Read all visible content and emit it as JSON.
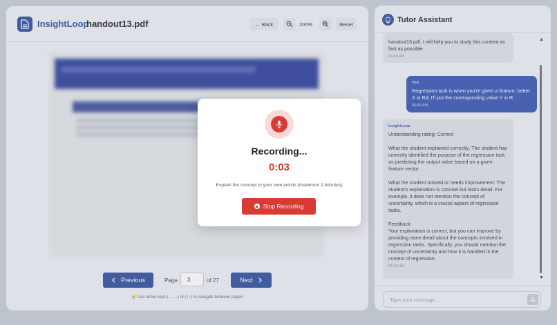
{
  "document": {
    "brand": "InsightLoop",
    "separator": "·",
    "filename": "handout13.pdf",
    "toolbar": {
      "back_label": "← Back",
      "zoom_level": "200%",
      "reset_label": "Reset"
    },
    "pager": {
      "previous_label": "Previous",
      "page_label": "Page",
      "current_page": "3",
      "of_label": "of 27",
      "next_label": "Next"
    },
    "hint": "Use arrow keys (← →) or (↑↓) to navigate between pages"
  },
  "chat": {
    "title": "Tutor Assistant",
    "messages": [
      {
        "role": "assistant",
        "text": "handout13.pdf. I will help you to study this content as fast as possible.",
        "time": "06:49 AM"
      },
      {
        "role": "user",
        "sender": "You",
        "text": "Regression task is when you're given a feature, better X in Rd, I'll put the corresponding value Y in R.",
        "time": "06:49 AM"
      },
      {
        "role": "assistant",
        "sender": "InsightLoop",
        "text": "Understanding rating: Correct\n\nWhat the student explained correctly: The student has correctly identified the purpose of the regression task as predicting the output value based on a given feature vector.\n\nWhat the student missed or needs improvement: The student's explanation is concise but lacks detail. For example, it does not mention the concept of uncertainty, which is a crucial aspect of regression tasks.\n\nFeedback:\nYour explanation is correct, but you can improve by providing more detail about the concepts involved in regression tasks. Specifically, you should mention the concept of uncertainty and how it is handled in the context of regression.",
        "time": "06:49 AM"
      }
    ],
    "input_placeholder": "Type your message..."
  },
  "modal": {
    "title": "Recording...",
    "timer": "0:03",
    "instructions": "Explain the concept in your own words (maximum 2 minutes)",
    "stop_label": "Stop Recording"
  },
  "colors": {
    "brand": "#2f4d9e",
    "user_bubble": "#3753b3",
    "record_red": "#d83a34"
  },
  "icons": [
    "document-icon",
    "zoom-out-icon",
    "zoom-in-icon",
    "chevron-left-icon",
    "chevron-right-icon",
    "lightbulb-icon",
    "tutor-lightbulb-icon",
    "send-icon",
    "microphone-icon",
    "stop-icon"
  ]
}
